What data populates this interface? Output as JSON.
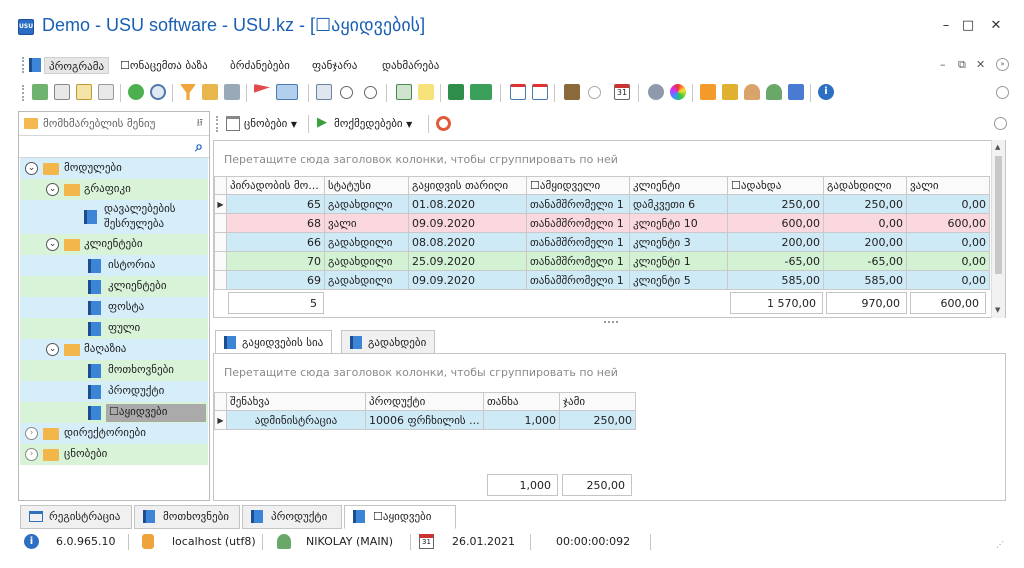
{
  "window": {
    "title": "Demo - USU software - USU.kz - [☐აყიდვების]",
    "app_icon_text": "USU",
    "minimize": "–",
    "maximize": "□",
    "close": "✕"
  },
  "menu": {
    "items": [
      "პროგრამა",
      "☐ონაცემთა ბაზა",
      "ბრძანებები",
      "ფანჯარა",
      "დახმარება"
    ],
    "mdi_min": "–",
    "mdi_restore": "⧉",
    "mdi_close": "✕"
  },
  "sidebar": {
    "title": "მომხმარებლის მენიუ",
    "pin": "⭿",
    "search_icon": "⌕",
    "tree": [
      {
        "label": "მოდულები"
      },
      {
        "label": "გრაფიკი"
      },
      {
        "label": "დავალებების"
      },
      {
        "label": "შესრულება"
      },
      {
        "label": "კლიენტები"
      },
      {
        "label": "ისტორია"
      },
      {
        "label": "კლიენტები"
      },
      {
        "label": "ფოსტა"
      },
      {
        "label": "ფული"
      },
      {
        "label": "მაღაზია"
      },
      {
        "label": "მოთხოვნები"
      },
      {
        "label": "პროდუქტი"
      },
      {
        "label": "☐აყიდვები"
      },
      {
        "label": "დირექტორიები"
      },
      {
        "label": "ცნობები"
      }
    ]
  },
  "module_toolbar": {
    "reports": "ცნობები",
    "actions": "მოქმედებები"
  },
  "main_grid": {
    "group_hint": "Перетащите сюда заголовок колонки, чтобы сгруппировать по ней",
    "columns": [
      "პირადობის მო...",
      "სტატუსი",
      "გაყიდვის თარიღი",
      "☐ამყიდველი",
      "კლიენტი",
      "☐ადახდა",
      "გადახდილი",
      "ვალი"
    ],
    "rows": [
      [
        "65",
        "გადახდილი",
        "01.08.2020",
        "თანამშრომელი 1",
        "დამკვეთი 6",
        "250,00",
        "250,00",
        "0,00"
      ],
      [
        "68",
        "ვალი",
        "09.09.2020",
        "თანამშრომელი 1",
        "კლიენტი 10",
        "600,00",
        "0,00",
        "600,00"
      ],
      [
        "66",
        "გადახდილი",
        "08.08.2020",
        "თანამშრომელი 1",
        "კლიენტი 3",
        "200,00",
        "200,00",
        "0,00"
      ],
      [
        "70",
        "გადახდილი",
        "25.09.2020",
        "თანამშრომელი 1",
        "კლიენტი 1",
        "-65,00",
        "-65,00",
        "0,00"
      ],
      [
        "69",
        "გადახდილი",
        "09.09.2020",
        "თანამშრომელი 1",
        "კლიენტი 5",
        "585,00",
        "585,00",
        "0,00"
      ]
    ],
    "footer": {
      "count": "5",
      "amount": "1 570,00",
      "paid": "970,00",
      "debt": "600,00"
    }
  },
  "detail": {
    "tabs": [
      "გაყიდვების სია",
      "გადახდები"
    ],
    "group_hint": "Перетащите сюда заголовок колонки, чтобы сгруппировать по ней",
    "columns": [
      "შენახვა",
      "პროდუქტი",
      "თანხა",
      "ჯამი"
    ],
    "rows": [
      [
        "ადმინისტრაცია",
        "10006 ფრჩხილის ...",
        "1,000",
        "250,00"
      ]
    ],
    "footer": {
      "qty": "1,000",
      "sum": "250,00"
    }
  },
  "doc_tabs": [
    "რეგისტრაცია",
    "მოთხოვნები",
    "პროდუქტი",
    "☐აყიდვები"
  ],
  "status": {
    "version": "6.0.965.10",
    "db": "localhost (utf8)",
    "user": "NIKOLAY (MAIN)",
    "date": "26.01.2021",
    "timer": "00:00:00:092",
    "calendar_day": "31"
  },
  "colors": {
    "accent": "#1a5fb4",
    "row_blue": "#cfeaf7",
    "row_pink": "#fbd7de",
    "row_green": "#d3f2d3",
    "tree_blue": "#d6eefa",
    "tree_green": "#d9f3d9"
  }
}
